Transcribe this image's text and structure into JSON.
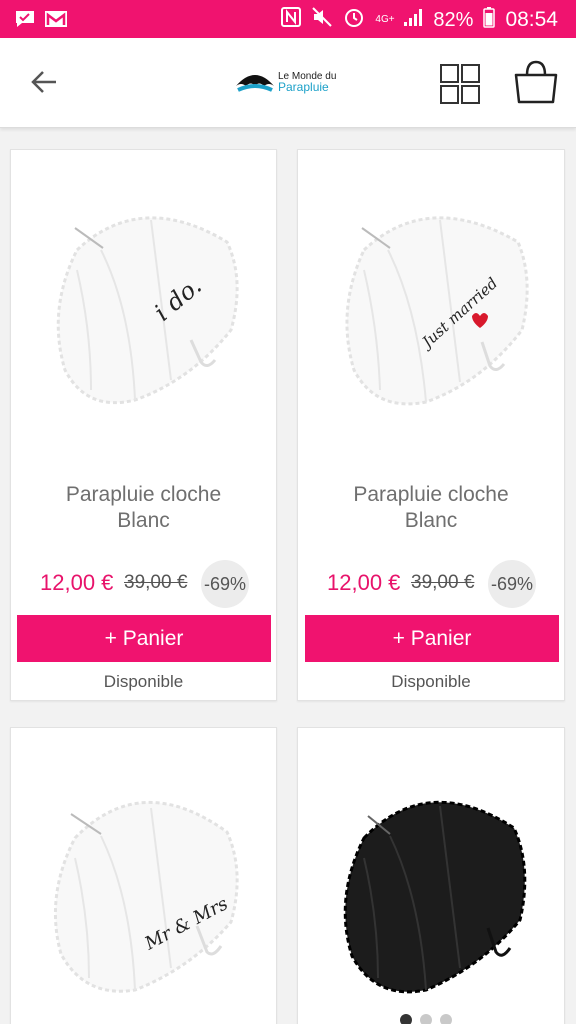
{
  "status_bar": {
    "battery": "82%",
    "time": "08:54",
    "network": "4G+",
    "icons": [
      "chat-icon",
      "gmail-icon",
      "nfc-icon",
      "mute-icon",
      "alarm-icon",
      "signal-icon",
      "battery-icon"
    ]
  },
  "header": {
    "logo_line1": "Le Monde du",
    "logo_line2": "Parapluie",
    "icons": [
      "back-arrow-icon",
      "grid-view-icon",
      "shopping-bag-icon"
    ]
  },
  "colors": {
    "accent": "#f0136f",
    "price": "#e8136b"
  },
  "products": [
    {
      "name": "Parapluie cloche Blanc",
      "price": "12,00 €",
      "old_price": "39,00 €",
      "discount": "-69%",
      "button": "+ Panier",
      "availability": "Disponible",
      "inscription": "i do."
    },
    {
      "name": "Parapluie cloche Blanc",
      "price": "12,00 €",
      "old_price": "39,00 €",
      "discount": "-69%",
      "button": "+ Panier",
      "availability": "Disponible",
      "inscription": "Just married"
    },
    {
      "inscription": "Mr & Mrs"
    },
    {
      "inscription": ""
    }
  ],
  "pager": {
    "count": 3,
    "active": 0
  }
}
